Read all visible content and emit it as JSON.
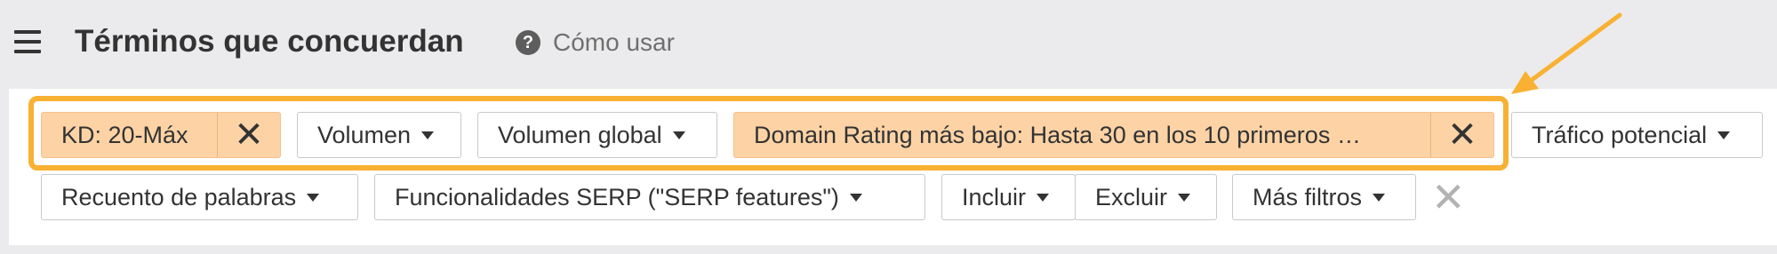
{
  "header": {
    "title": "Términos que concuerdan",
    "help_label": "Cómo usar",
    "help_icon": "?"
  },
  "filters": {
    "active": [
      {
        "label": "KD: 20-Máx",
        "remove": "✕"
      },
      {
        "label": "Domain Rating más bajo: Hasta 30 en los 10 primeros …",
        "remove": "✕"
      }
    ],
    "row1": [
      "Volumen",
      "Volumen global",
      "Tráfico potencial"
    ],
    "row2": [
      "Recuento de palabras",
      "Funcionalidades SERP (\"SERP features\")",
      "Incluir",
      "Excluir",
      "Más filtros"
    ],
    "clear_all": "✕"
  },
  "colors": {
    "active_chip": "#fdd3a6",
    "annotation": "#f8b133",
    "background": "#ebebed"
  },
  "icons": [
    "menu-icon",
    "help-icon",
    "caret-down-icon",
    "close-icon",
    "arrow-annotation"
  ]
}
